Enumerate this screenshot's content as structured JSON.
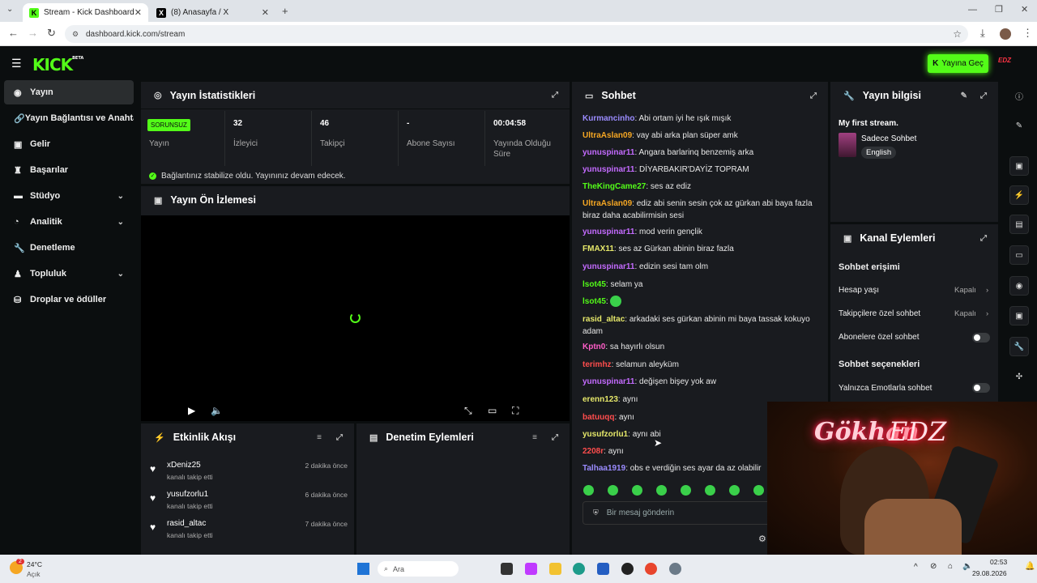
{
  "browser": {
    "tabs": [
      {
        "title": "Stream - Kick Dashboard",
        "active": true
      },
      {
        "title": "(8) Anasayfa / X",
        "active": false
      }
    ],
    "url": "dashboard.kick.com/stream"
  },
  "header": {
    "logo": "KICK",
    "logo_tag": "BETA",
    "go_live": "Yayına Geç",
    "profile_badge": "EDZ"
  },
  "sidebar": {
    "items": [
      {
        "label": "Yayın",
        "icon": "radio-icon",
        "active": true
      },
      {
        "label": "Yayın Bağlantısı ve Anahtarı",
        "icon": "link-icon"
      },
      {
        "label": "Gelir",
        "icon": "wallet-icon"
      },
      {
        "label": "Başarılar",
        "icon": "trophy-icon"
      },
      {
        "label": "Stüdyo",
        "icon": "studio-icon",
        "expandable": true
      },
      {
        "label": "Analitik",
        "icon": "chart-icon",
        "expandable": true
      },
      {
        "label": "Denetleme",
        "icon": "wrench-icon"
      },
      {
        "label": "Topluluk",
        "icon": "users-icon",
        "expandable": true
      },
      {
        "label": "Droplar ve ödüller",
        "icon": "gift-icon"
      }
    ]
  },
  "stats": {
    "title": "Yayın İstatistikleri",
    "badge": "SORUNSUZ",
    "items": [
      {
        "value": "",
        "label": "Yayın"
      },
      {
        "value": "32",
        "label": "İzleyici"
      },
      {
        "value": "46",
        "label": "Takipçi"
      },
      {
        "value": "-",
        "label": "Abone Sayısı"
      },
      {
        "value": "00:04:58",
        "label": "Yayında Olduğu Süre"
      }
    ],
    "stable_msg": "Bağlantınız stabilize oldu. Yayınınız devam edecek."
  },
  "preview": {
    "title": "Yayın Ön İzlemesi"
  },
  "activity": {
    "title": "Etkinlik Akışı",
    "items": [
      {
        "name": "xDeniz25",
        "sub": "kanalı takip etti",
        "time": "2 dakika önce"
      },
      {
        "name": "yusufzorlu1",
        "sub": "kanalı takip etti",
        "time": "6 dakika önce"
      },
      {
        "name": "rasid_altac",
        "sub": "kanalı takip etti",
        "time": "7 dakika önce"
      }
    ]
  },
  "moderation": {
    "title": "Denetim Eylemleri"
  },
  "chat": {
    "title": "Sohbet",
    "placeholder": "Bir mesaj gönderin",
    "messages": [
      {
        "user": "Kurmancinho",
        "color": "#9b8cff",
        "text": "Abi ortam iyi he ışık mışık"
      },
      {
        "user": "UltraAslan09",
        "color": "#f5a623",
        "text": "vay abi arka plan süper amk"
      },
      {
        "user": "yunuspinar11",
        "color": "#c46bff",
        "text": "Angara barlarinq benzemiş arka"
      },
      {
        "user": "yunuspinar11",
        "color": "#c46bff",
        "text": "DİYARBAKIR'DAYİZ TOPRAM"
      },
      {
        "user": "TheKingCame27",
        "color": "#53fc18",
        "text": "ses az ediz"
      },
      {
        "user": "UltraAslan09",
        "color": "#f5a623",
        "text": "ediz abi senin sesin çok az gürkan abi baya fazla biraz daha acabilirmisin sesi"
      },
      {
        "user": "yunuspinar11",
        "color": "#c46bff",
        "text": "mod verin gençlik"
      },
      {
        "user": "FMAX11",
        "color": "#e6e86a",
        "text": "ses az Gürkan abinin biraz fazla"
      },
      {
        "user": "yunuspinar11",
        "color": "#c46bff",
        "text": "edizin sesi tam olm"
      },
      {
        "user": "lsot45",
        "color": "#53fc18",
        "text": "selam ya"
      },
      {
        "user": "lsot45",
        "color": "#53fc18",
        "text": ""
      },
      {
        "user": "rasid_altac",
        "color": "#e6e86a",
        "text": "arkadaki ses gürkan abinin mi baya tassak kokuyo adam"
      },
      {
        "user": "Kptn0",
        "color": "#ff5ec8",
        "text": "sa hayırlı olsun"
      },
      {
        "user": "terimhz",
        "color": "#ff4d4d",
        "text": "selamun aleyküm"
      },
      {
        "user": "yunuspinar11",
        "color": "#c46bff",
        "text": "değişen bişey yok aw"
      },
      {
        "user": "erenn123",
        "color": "#e6e86a",
        "text": "aynı"
      },
      {
        "user": "batuuqq",
        "color": "#ff4d4d",
        "text": "aynı"
      },
      {
        "user": "yusufzorlu1",
        "color": "#e6e86a",
        "text": "aynı abi"
      },
      {
        "user": "2208r",
        "color": "#ff4d4d",
        "text": "aynı"
      },
      {
        "user": "Talhaa1919",
        "color": "#9b8cff",
        "text": "obs e verdiğin ses ayar da az olabilir"
      }
    ]
  },
  "stream_info": {
    "title": "Yayın bilgisi",
    "stream_title": "My first stream.",
    "category": "Sadece Sohbet",
    "language": "English"
  },
  "channel_actions": {
    "title": "Kanal Eylemleri",
    "access_heading": "Sohbet erişimi",
    "rows": [
      {
        "label": "Hesap yaşı",
        "value": "Kapalı"
      },
      {
        "label": "Takipçilere özel sohbet",
        "value": "Kapalı"
      },
      {
        "label": "Abonelere özel sohbet",
        "value": ""
      }
    ],
    "options_heading": "Sohbet seçenekleri",
    "emote_only": "Yalnızca Emotlarla sohbet"
  },
  "webcam": {
    "neon_left": "Gökhan",
    "neon_right": "EDZ"
  },
  "taskbar": {
    "weather_temp": "24°C",
    "weather_desc": "Açık",
    "search": "Ara",
    "time": "02:53",
    "date": "29.08.2026",
    "notification_count": "2"
  },
  "colors": {
    "accent": "#53fc18",
    "panel": "#191b1f",
    "bg": "#0b0e0f"
  }
}
